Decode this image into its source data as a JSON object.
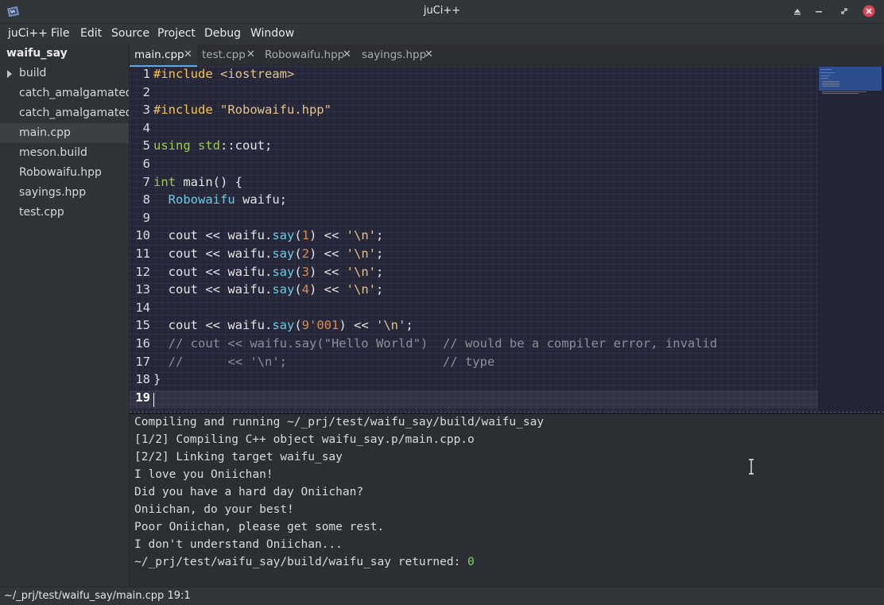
{
  "window": {
    "title": "juCi++"
  },
  "menubar": [
    "juCi++",
    "File",
    "Edit",
    "Source",
    "Project",
    "Debug",
    "Window"
  ],
  "sidebar": {
    "root": "waifu_say",
    "items": [
      "build",
      "catch_amalgamated.cpp",
      "catch_amalgamated.hpp",
      "main.cpp",
      "meson.build",
      "Robowaifu.hpp",
      "sayings.hpp",
      "test.cpp"
    ],
    "selected": "main.cpp"
  },
  "tabs": [
    {
      "label": "main.cpp",
      "close": "✕",
      "active": true
    },
    {
      "label": "test.cpp",
      "close": "✕",
      "active": false
    },
    {
      "label": "Robowaifu.hpp",
      "close": "✕",
      "active": false
    },
    {
      "label": "sayings.hpp",
      "close": "✕",
      "active": false
    }
  ],
  "editor": {
    "lines": [
      "#include <iostream>",
      "",
      "#include \"Robowaifu.hpp\"",
      "",
      "using std::cout;",
      "",
      "int main() {",
      "  Robowaifu waifu;",
      "",
      "  cout << waifu.say(1) << '\\n';",
      "  cout << waifu.say(2) << '\\n';",
      "  cout << waifu.say(3) << '\\n';",
      "  cout << waifu.say(4) << '\\n';",
      "",
      "  cout << waifu.say(9'001) << '\\n';",
      "  // cout << waifu.say(\"Hello World\")  // would be a compiler error, invalid",
      "  //      << '\\n';                     // type",
      "}",
      ""
    ],
    "current_line": 19
  },
  "terminal": {
    "lines": [
      "Compiling and running ~/_prj/test/waifu_say/build/waifu_say",
      "[1/2] Compiling C++ object waifu_say.p/main.cpp.o",
      "[2/2] Linking target waifu_say",
      "I love you Oniichan!",
      "Did you have a hard day Oniichan?",
      "Oniichan, do your best!",
      "Poor Oniichan, please get some rest.",
      "I don't understand Oniichan..."
    ],
    "return_prefix": "~/_prj/test/waifu_say/build/waifu_say returned: ",
    "return_code": "0"
  },
  "statusbar": {
    "text": "~/_prj/test/waifu_say/main.cpp 19:1"
  },
  "colors": {
    "accent": "#5aa9e6",
    "editor_bg": "#252638",
    "preprocessor": "#f5c445",
    "string": "#e2c48a",
    "keyword": "#9ecd43",
    "type": "#6ac9e0",
    "number": "#dd8a4b",
    "comment": "#8c8f96",
    "return_ok": "#7ed56f"
  },
  "icons": {
    "app": "jucipp-app-icon",
    "sidebar_expand": "triangle-right-icon",
    "tab_close": "close-icon",
    "win_keep_above": "keep-above-icon",
    "win_minimize": "minimize-icon",
    "win_maximize": "maximize-icon",
    "win_close": "close-circle-icon",
    "cursor": "ibeam-cursor-icon"
  }
}
